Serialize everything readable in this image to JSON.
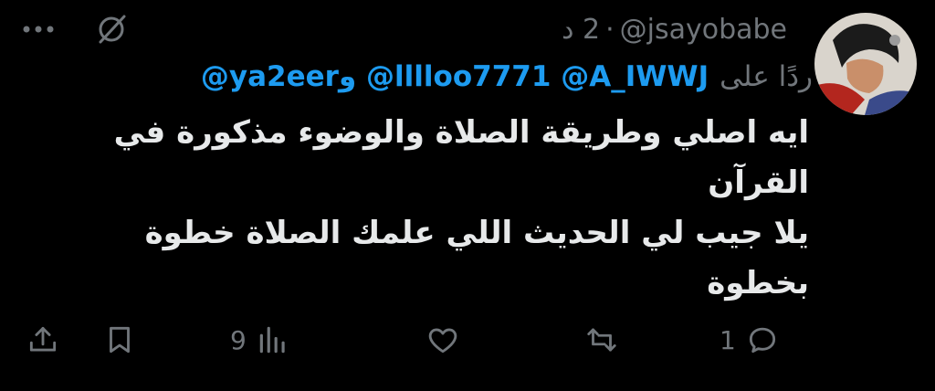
{
  "tweet": {
    "handle": "@jsayobabe",
    "separator": "·",
    "time": "2 د",
    "reply_label": "ردًا على",
    "mentions": "@ya2eerو @lllloo7771 @A_IWWJ",
    "lines": [
      "ايه اصلي وطريقة الصلاة والوضوء مذكورة في",
      "القرآن",
      "يلا جيب لي الحديث اللي علمك الصلاة خطوة",
      "بخطوة"
    ]
  },
  "actions": {
    "reply_count": "1",
    "retweet_count": "",
    "like_count": "",
    "views_count": "9"
  },
  "colors": {
    "background": "#000000",
    "text": "#e7e9ea",
    "muted": "#71767b",
    "link": "#1d9bf0"
  },
  "icons": [
    "more-icon",
    "grok-icon",
    "reply-icon",
    "retweet-icon",
    "like-icon",
    "views-icon",
    "bookmark-icon",
    "share-icon"
  ]
}
